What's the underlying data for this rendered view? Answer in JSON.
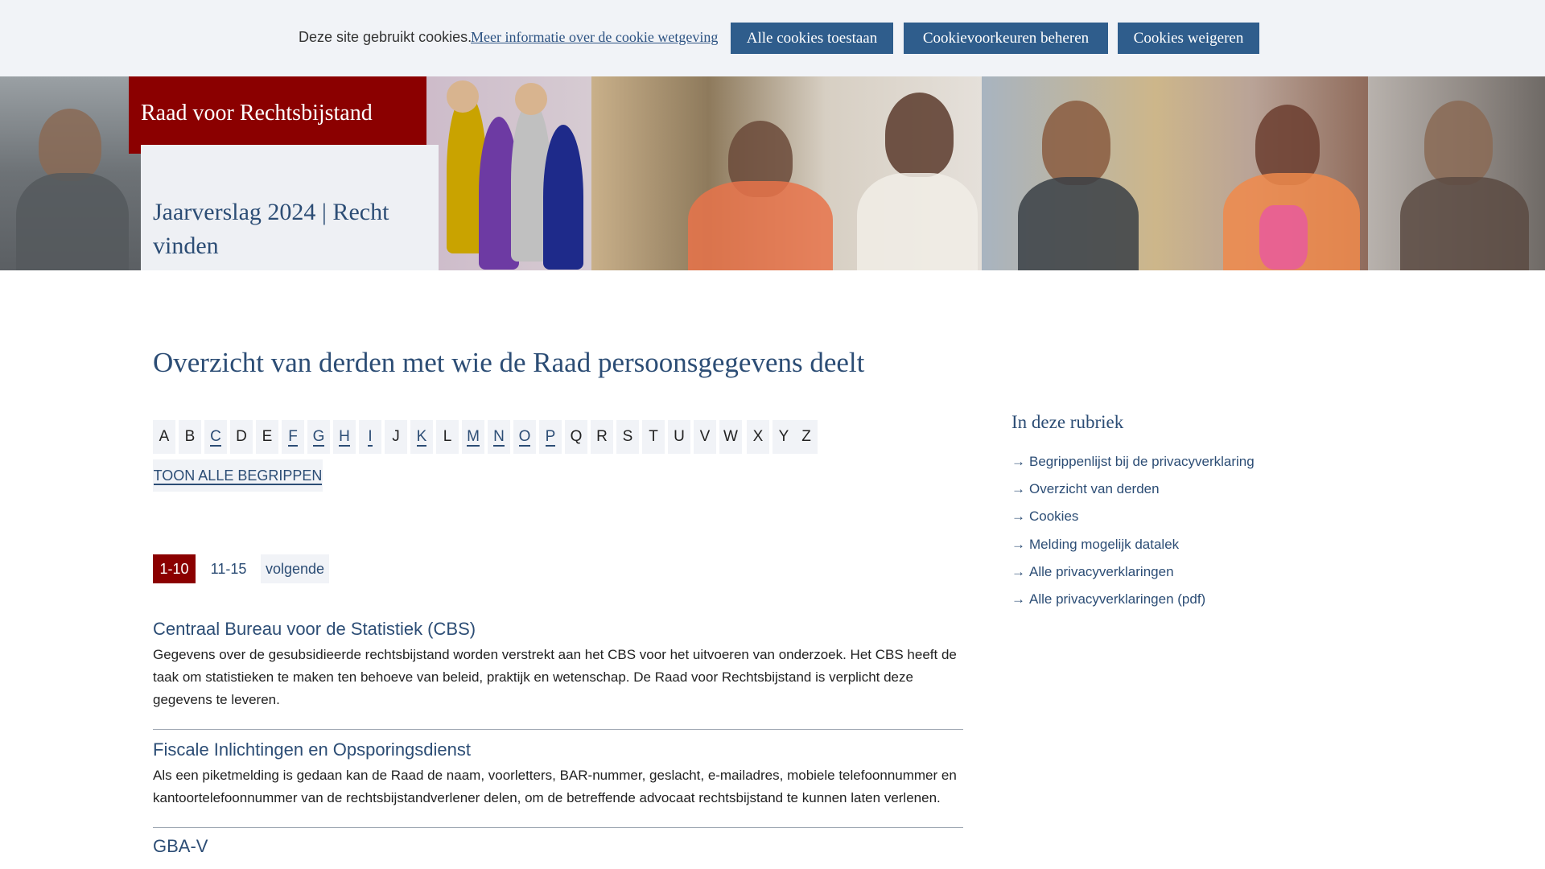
{
  "cookie_bar": {
    "text": "Deze site gebruikt cookies.",
    "more_info_link": "Meer informatie over de cookie wetgeving",
    "accept_all": "Alle cookies toestaan",
    "manage": "Cookievoorkeuren beheren",
    "decline": "Cookies weigeren"
  },
  "header": {
    "brand": "Raad voor Rechtsbijstand",
    "site_title": "Jaarverslag 2024 | Recht vinden"
  },
  "main": {
    "heading": "Overzicht van derden met wie de Raad persoonsgegevens deelt",
    "alphabet": [
      {
        "letter": "A",
        "linked": false
      },
      {
        "letter": "B",
        "linked": false
      },
      {
        "letter": "C",
        "linked": true
      },
      {
        "letter": "D",
        "linked": false
      },
      {
        "letter": "E",
        "linked": false
      },
      {
        "letter": "F",
        "linked": true
      },
      {
        "letter": "G",
        "linked": true
      },
      {
        "letter": "H",
        "linked": true
      },
      {
        "letter": "I",
        "linked": true
      },
      {
        "letter": "J",
        "linked": false
      },
      {
        "letter": "K",
        "linked": true
      },
      {
        "letter": "L",
        "linked": false
      },
      {
        "letter": "M",
        "linked": true
      },
      {
        "letter": "N",
        "linked": true
      },
      {
        "letter": "O",
        "linked": true
      },
      {
        "letter": "P",
        "linked": true
      },
      {
        "letter": "Q",
        "linked": false
      },
      {
        "letter": "R",
        "linked": false
      },
      {
        "letter": "S",
        "linked": false
      },
      {
        "letter": "T",
        "linked": false
      },
      {
        "letter": "U",
        "linked": false
      },
      {
        "letter": "V",
        "linked": false
      },
      {
        "letter": "W",
        "linked": false
      },
      {
        "letter": "X",
        "linked": false
      },
      {
        "letter": "Y",
        "linked": false
      },
      {
        "letter": "Z",
        "linked": false
      }
    ],
    "show_all": "TOON ALLE BEGRIPPEN",
    "pagination": {
      "current": "1-10",
      "page2": "11-15",
      "next": "volgende"
    },
    "entries": [
      {
        "title": "Centraal Bureau voor de Statistiek (CBS)",
        "lines": [
          "Gegevens over de gesubsidieerde rechtsbijstand worden verstrekt aan het CBS voor het uitvoeren van onderzoek. Het CBS heeft de",
          "taak om statistieken te maken ten behoeve van beleid, praktijk en wetenschap. De Raad voor Rechtsbijstand is verplicht deze",
          "gegevens te leveren."
        ]
      },
      {
        "title": "Fiscale Inlichtingen en Opsporingsdienst",
        "lines": [
          "Als een piketmelding is gedaan kan de Raad de naam, voorletters, BAR-nummer, geslacht, e-mailadres, mobiele telefoonnummer en",
          "kantoortelefoonnummer van de rechtsbijstandverlener delen, om de betreffende advocaat rechtsbijstand te kunnen laten verlenen."
        ]
      },
      {
        "title": "GBA-V",
        "lines": []
      }
    ]
  },
  "sidebar": {
    "heading": "In deze rubriek",
    "items": [
      "Begrippenlijst bij de privacyverklaring",
      "Overzicht van derden",
      "Cookies",
      "Melding mogelijk datalek",
      "Alle privacyverklaringen",
      "Alle privacyverklaringen (pdf)"
    ]
  },
  "colors": {
    "brand_red": "#8b0000",
    "link_blue": "#2c4d75",
    "button_blue": "#2f5d8c",
    "light_bg": "#f1f3f7"
  }
}
